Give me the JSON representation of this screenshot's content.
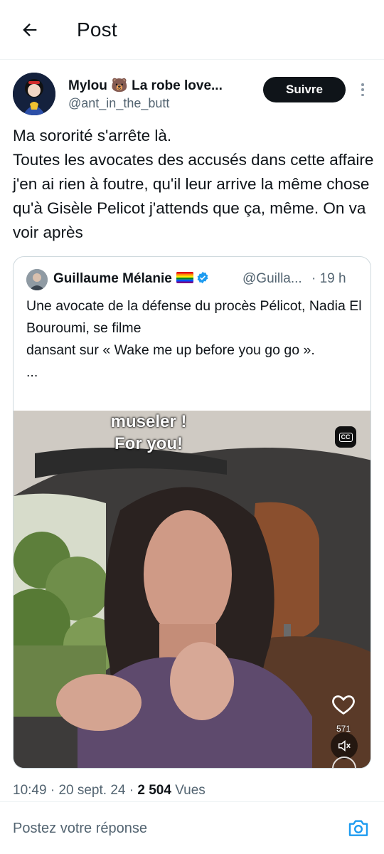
{
  "header": {
    "title": "Post",
    "back_icon": "arrow-left-icon"
  },
  "author": {
    "name": "Mylou 🐻 La robe love...",
    "handle": "@ant_in_the_butt",
    "follow_label": "Suivre"
  },
  "post": {
    "text": "Ma sororité s'arrête là.\nToutes les avocates des accusés dans cette affaire j'en ai rien à foutre, qu'il leur arrive la même chose qu'à Gisèle Pelicot j'attends que ça, même. On va voir après"
  },
  "quote": {
    "name": "Guillaume Mélanie",
    "handle": "@Guilla...",
    "time": "· 19 h",
    "text": "Une avocate de la défense du procès Pélicot, Nadia El Bouroumi, se filme\ndansant sur « Wake me up before you go go ».\n...",
    "video": {
      "caption_line1": "museler !",
      "caption_line2": "For you!",
      "cc_label": "CC",
      "like_count": "571"
    }
  },
  "meta": {
    "time": "10:49",
    "date": "20 sept. 24",
    "views_count": "2 504",
    "views_label": "Vues"
  },
  "reply": {
    "placeholder": "Postez votre réponse"
  },
  "colors": {
    "accent": "#1d9bf0",
    "text": "#0f1419",
    "muted": "#536471",
    "border": "#cfd9de"
  }
}
